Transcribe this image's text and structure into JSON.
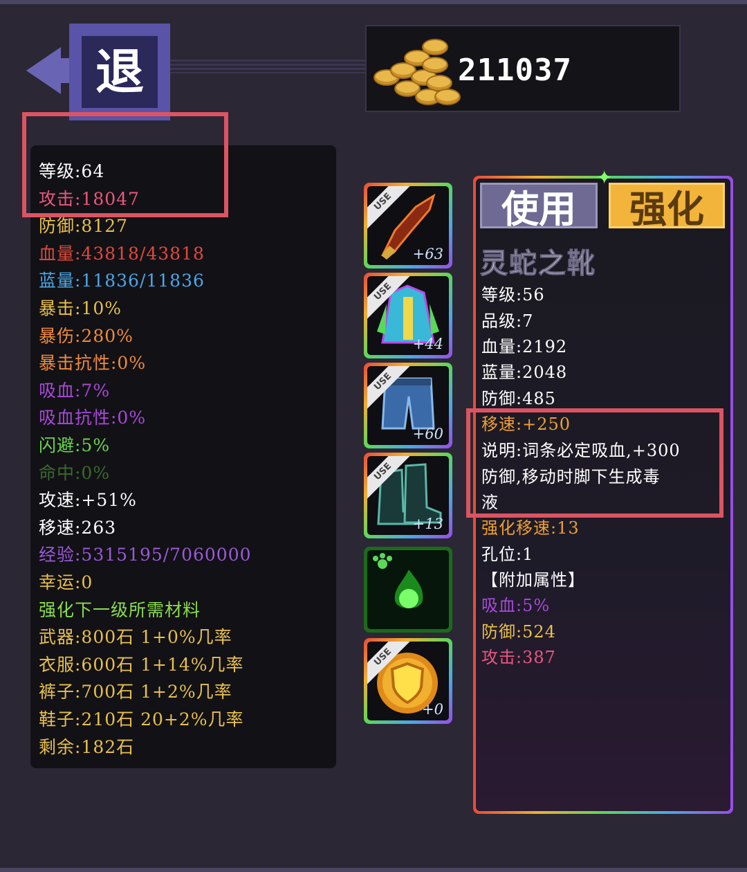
{
  "header": {
    "back_label": "退",
    "coins": "211037"
  },
  "stats": [
    {
      "text": "等级:64",
      "color": "#ffffff"
    },
    {
      "text": "攻击:18047",
      "color": "#e9587e"
    },
    {
      "text": "防御:8127",
      "color": "#e8c14a"
    },
    {
      "text": "血量:43818/43818",
      "color": "#e14a3a"
    },
    {
      "text": "蓝量:11836/11836",
      "color": "#4aa8e8"
    },
    {
      "text": "暴击:10%",
      "color": "#e8c14a"
    },
    {
      "text": "暴伤:280%",
      "color": "#f08c3a"
    },
    {
      "text": "暴击抗性:0%",
      "color": "#f08c3a"
    },
    {
      "text": "吸血:7%",
      "color": "#a84ad8"
    },
    {
      "text": "吸血抗性:0%",
      "color": "#a84ad8"
    },
    {
      "text": "闪避:5%",
      "color": "#6ad84a"
    },
    {
      "text": "命中:0%",
      "color": "#3a6a2a"
    },
    {
      "text": "攻速:+51%",
      "color": "#ffffff"
    },
    {
      "text": "移速:263",
      "color": "#ffffff"
    },
    {
      "text": "经验:5315195/7060000",
      "color": "#9a5ad8"
    },
    {
      "text": "幸运:0",
      "color": "#e8c14a"
    },
    {
      "text": "强化下一级所需材料",
      "color": "#8ade4a"
    },
    {
      "text": "武器:800石 1+0%几率",
      "color": "#e8c14a"
    },
    {
      "text": "衣服:600石 1+14%几率",
      "color": "#e8c14a"
    },
    {
      "text": "裤子:700石 1+2%几率",
      "color": "#e8c14a"
    },
    {
      "text": "鞋子:210石 20+2%几率",
      "color": "#e8c14a"
    },
    {
      "text": "剩余:182石",
      "color": "#e8c14a"
    }
  ],
  "slots": [
    {
      "item": "weapon-blade",
      "use_badge": "USE",
      "level": "+63"
    },
    {
      "item": "robe",
      "use_badge": "USE",
      "level": "+44"
    },
    {
      "item": "pants",
      "use_badge": "USE",
      "level": "+60"
    },
    {
      "item": "boots",
      "use_badge": "USE",
      "level": "+13"
    },
    {
      "item": "green-orb-pet",
      "use_badge": "",
      "level": ""
    },
    {
      "item": "gold-shield",
      "use_badge": "USE",
      "level": "+0"
    }
  ],
  "detail": {
    "tab_use": "使用",
    "tab_upgrade": "强化",
    "item_name": "灵蛇之靴",
    "lines": [
      {
        "text": "等级:56",
        "color": "#ffffff"
      },
      {
        "text": "品级:7",
        "color": "#ffffff"
      },
      {
        "text": "血量:2192",
        "color": "#ffffff"
      },
      {
        "text": "蓝量:2048",
        "color": "#ffffff"
      },
      {
        "text": "防御:485",
        "color": "#ffffff"
      },
      {
        "text": "移速:+250",
        "color": "#f0a030"
      },
      {
        "text": "说明:词条必定吸血,+300",
        "color": "#ffffff"
      },
      {
        "text": "防御,移动时脚下生成毒",
        "color": "#ffffff"
      },
      {
        "text": "液",
        "color": "#ffffff"
      },
      {
        "text": "强化移速:13",
        "color": "#f0a030"
      },
      {
        "text": "孔位:1",
        "color": "#ffffff"
      },
      {
        "text": "【附加属性】",
        "color": "#ffffff"
      },
      {
        "text": "吸血:5%",
        "color": "#a84ad8"
      },
      {
        "text": "防御:524",
        "color": "#e8c14a"
      },
      {
        "text": "攻击:387",
        "color": "#e9587e"
      }
    ]
  }
}
